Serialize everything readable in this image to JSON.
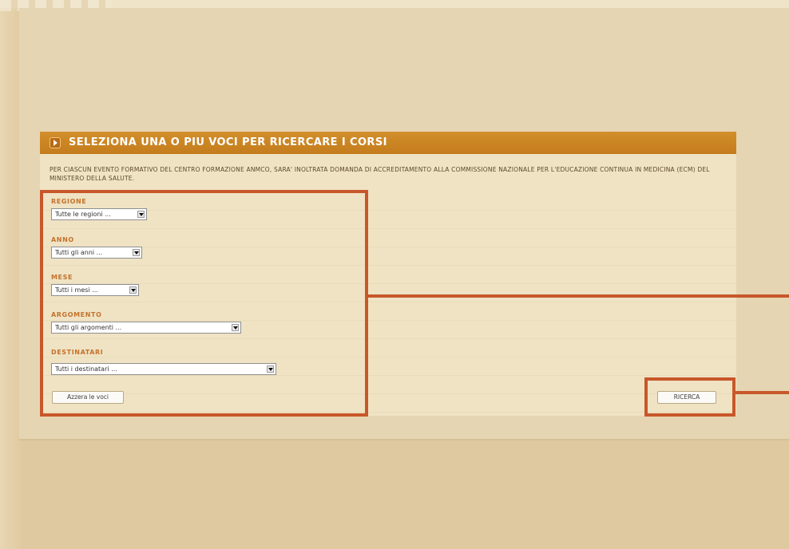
{
  "search": {
    "title": "SELEZIONA UNA O PIU VOCI PER RICERCARE I CORSI",
    "intro": "PER CIASCUN EVENTO FORMATIVO DEL CENTRO FORMAZIONE ANMCO, SARA' INOLTRATA DOMANDA DI ACCREDITAMENTO ALLA COMMISSIONE NAZIONALE PER L'EDUCAZIONE CONTINUA IN MEDICINA (ECM) DEL MINISTERO DELLA SALUTE.",
    "fields": {
      "regione": {
        "label": "REGIONE",
        "value": "Tutte le regioni ..."
      },
      "anno": {
        "label": "ANNO",
        "value": "Tutti gli anni ..."
      },
      "mese": {
        "label": "MESE",
        "value": "Tutti i mesi ..."
      },
      "argomento": {
        "label": "ARGOMENTO",
        "value": "Tutti gli argomenti ..."
      },
      "destinatari": {
        "label": "DESTINATARI",
        "value": "Tutti i destinatari ..."
      }
    },
    "reset_label": "Azzera le voci",
    "search_label": "RICERCA"
  },
  "colors": {
    "header": "#c98420",
    "panel": "#efe3c4",
    "label": "#c4722b",
    "callout": "#c8572a",
    "background": "#dfc9a0"
  }
}
